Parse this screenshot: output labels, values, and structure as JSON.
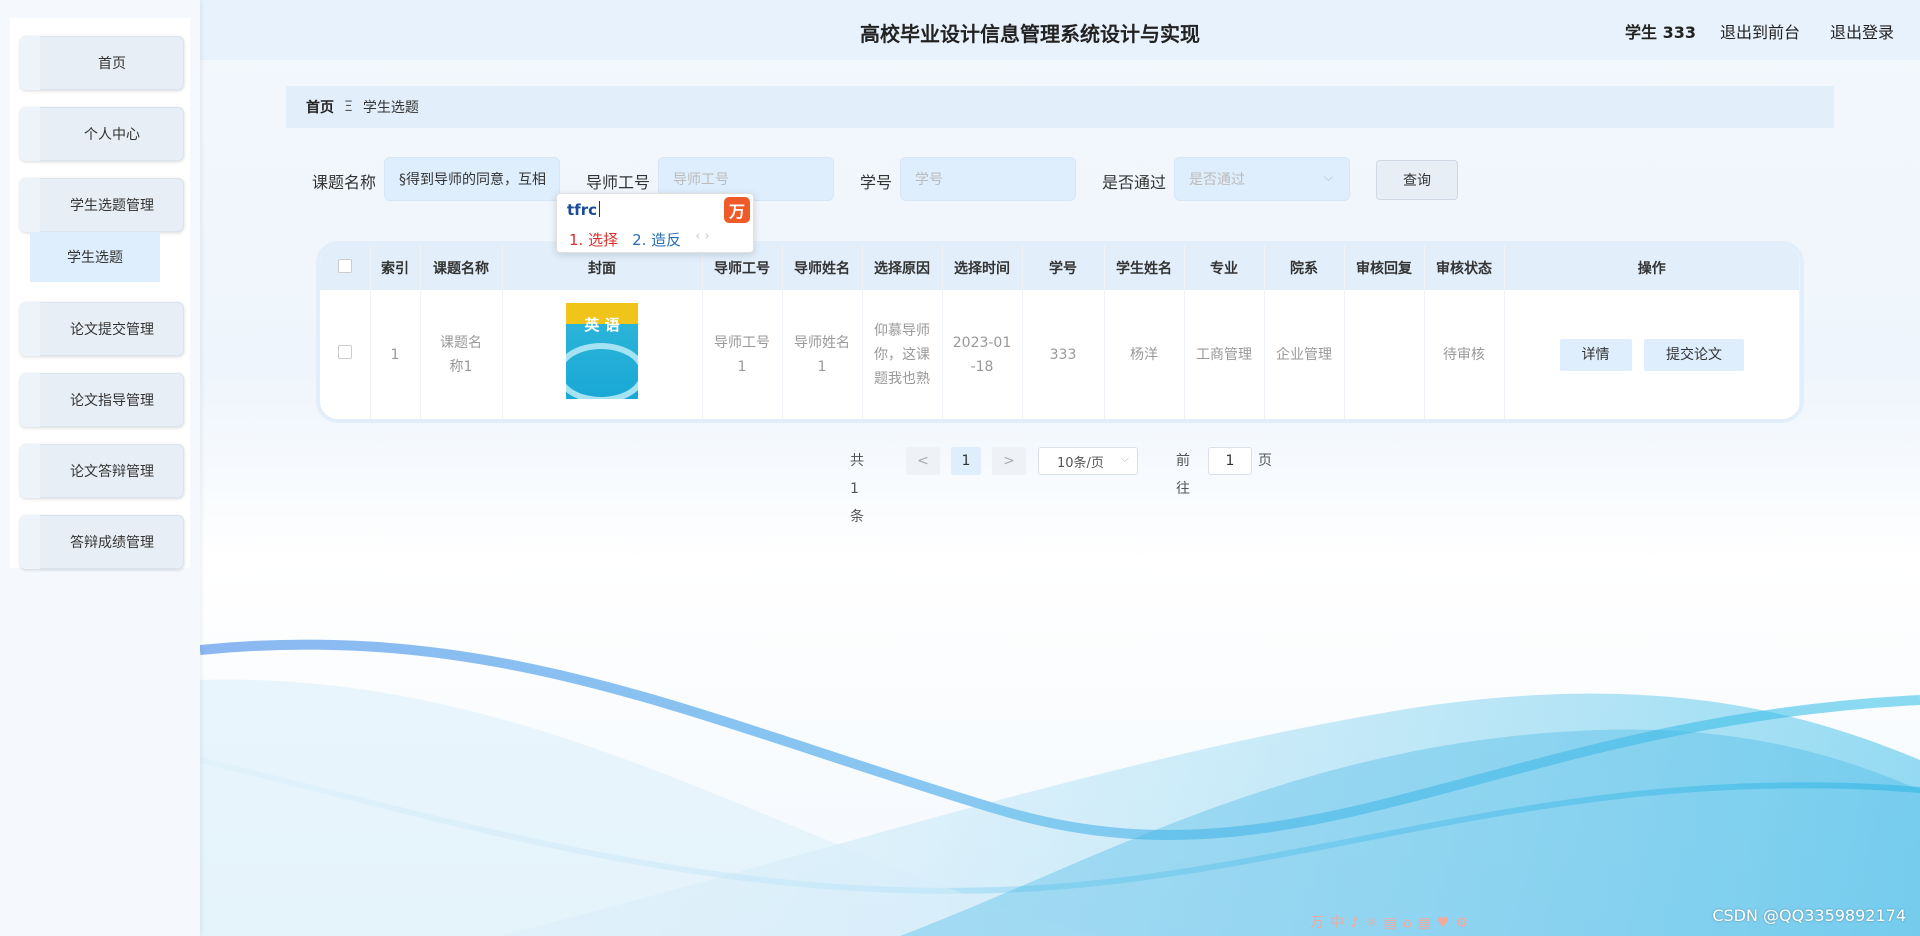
{
  "sidebar": {
    "items": [
      {
        "label": "首页"
      },
      {
        "label": "个人中心"
      },
      {
        "label": "学生选题管理"
      },
      {
        "label": "论文提交管理"
      },
      {
        "label": "论文指导管理"
      },
      {
        "label": "论文答辩管理"
      },
      {
        "label": "答辩成绩管理"
      }
    ],
    "submenu_active": "学生选题"
  },
  "header": {
    "title": "高校毕业设计信息管理系统设计与实现",
    "user": "学生 333",
    "back_front": "退出到前台",
    "logout": "退出登录"
  },
  "breadcrumb": {
    "home": "首页",
    "separator": "Ξ",
    "current": "学生选题"
  },
  "search": {
    "topic_label": "课题名称",
    "topic_value": "§得到导师的同意，互相",
    "tutor_id_label": "导师工号",
    "tutor_id_placeholder": "导师工号",
    "student_id_label": "学号",
    "student_id_placeholder": "学号",
    "passed_label": "是否通过",
    "passed_placeholder": "是否通过",
    "query_button": "查询"
  },
  "ime": {
    "input": "tfrc",
    "logo": "万",
    "candidate1": "1. 选择",
    "candidate2": "2. 造反",
    "arrows": "‹ ›"
  },
  "table": {
    "columns": [
      "",
      "索引",
      "课题名称",
      "封面",
      "导师工号",
      "导师姓名",
      "选择原因",
      "选择时间",
      "学号",
      "学生姓名",
      "专业",
      "院系",
      "审核回复",
      "审核状态",
      "操作"
    ],
    "rows": [
      {
        "index": "1",
        "topic": "课题名称1",
        "cover_title": "英 语",
        "tutor_id": "导师工号1",
        "tutor_name": "导师姓名1",
        "reason": "仰慕导师你，这课题我也熟",
        "time": "2023-01-18",
        "student_id": "333",
        "student_name": "杨洋",
        "major": "工商管理",
        "department": "企业管理",
        "reply": "",
        "status": "待审核",
        "detail_btn": "详情",
        "submit_btn": "提交论文"
      }
    ]
  },
  "pagination": {
    "total": "共 1 条",
    "prev": "<",
    "current_page": "1",
    "next": ">",
    "page_size": "10条/页",
    "goto_prefix": "前往",
    "goto_value": "1",
    "goto_suffix": "页"
  },
  "watermark": "CSDN @QQ3359892174",
  "colors": {
    "header_bg": "#e8f2fc",
    "accent_light": "#dfeefc",
    "wave": "#3fb4e6"
  }
}
